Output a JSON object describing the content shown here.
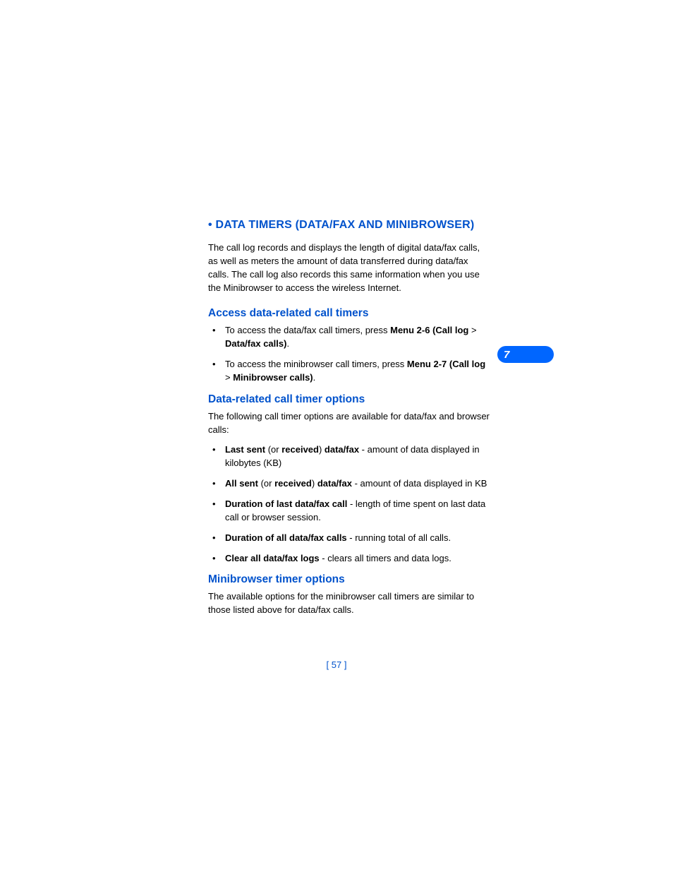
{
  "chapterNumber": "7",
  "pageNumber": "[ 57 ]",
  "sections": {
    "main": {
      "heading": "•  DATA TIMERS (DATA/FAX AND MINIBROWSER)",
      "intro": "The call log records and displays the length of digital data/fax calls, as well as meters the amount of data transferred during data/fax calls. The call log also records this same information when you use the Minibrowser to access the wireless Internet."
    },
    "access": {
      "heading": "Access data-related call timers",
      "items": [
        {
          "pre": "To access the data/fax call timers, press ",
          "bold1": "Menu 2-6 (Call log",
          "mid": " > ",
          "bold2": "Data/fax calls)",
          "post": "."
        },
        {
          "pre": "To access the minibrowser call timers, press ",
          "bold1": "Menu 2-7 (Call log",
          "mid": " > ",
          "bold2": "Minibrowser calls)",
          "post": "."
        }
      ]
    },
    "options": {
      "heading": "Data-related call timer options",
      "intro": "The following call timer options are available for data/fax and browser calls:",
      "items": [
        {
          "bold1": "Last sent",
          "mid1": " (or ",
          "bold2": "received",
          "mid2": ") ",
          "bold3": "data/fax",
          "post": " - amount of data displayed in kilobytes (KB)"
        },
        {
          "bold1": "All sent",
          "mid1": " (or ",
          "bold2": "received",
          "mid2": ") ",
          "bold3": "data/fax",
          "post": " - amount of data displayed in KB"
        },
        {
          "bold1": "Duration of last data/fax call",
          "post": " - length of time spent on last data call or browser session."
        },
        {
          "bold1": "Duration of all data/fax calls",
          "post": " - running total of all calls."
        },
        {
          "bold1": "Clear all data/fax logs",
          "post": " - clears all timers and data logs."
        }
      ]
    },
    "minibrowser": {
      "heading": "Minibrowser timer options",
      "intro": "The available options for the minibrowser call timers are similar to those listed above for data/fax calls."
    }
  }
}
